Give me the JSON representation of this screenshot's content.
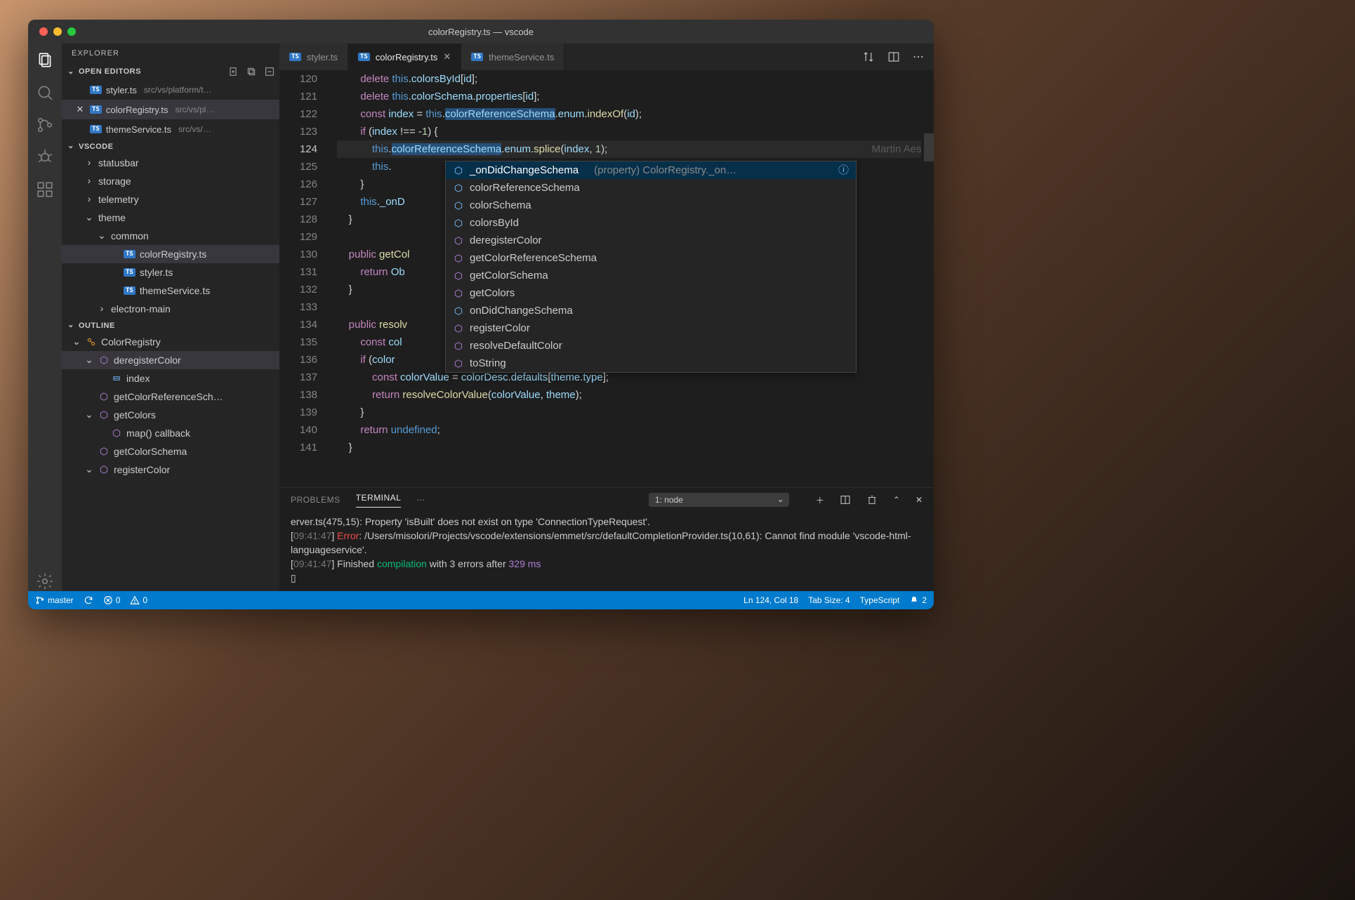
{
  "title": "colorRegistry.ts — vscode",
  "sidebar": {
    "title": "EXPLORER",
    "openEditors": {
      "label": "OPEN EDITORS",
      "items": [
        {
          "name": "styler.ts",
          "path": "src/vs/platform/t…"
        },
        {
          "name": "colorRegistry.ts",
          "path": "src/vs/pl…",
          "active": true
        },
        {
          "name": "themeService.ts",
          "path": "src/vs/…"
        }
      ]
    },
    "workspace": {
      "label": "VSCODE",
      "tree": [
        {
          "indent": 1,
          "chev": "›",
          "label": "statusbar"
        },
        {
          "indent": 1,
          "chev": "›",
          "label": "storage"
        },
        {
          "indent": 1,
          "chev": "›",
          "label": "telemetry"
        },
        {
          "indent": 1,
          "chev": "⌄",
          "label": "theme"
        },
        {
          "indent": 2,
          "chev": "⌄",
          "label": "common"
        },
        {
          "indent": 3,
          "chev": "",
          "label": "colorRegistry.ts",
          "ts": true,
          "active": true
        },
        {
          "indent": 3,
          "chev": "",
          "label": "styler.ts",
          "ts": true
        },
        {
          "indent": 3,
          "chev": "",
          "label": "themeService.ts",
          "ts": true
        },
        {
          "indent": 2,
          "chev": "›",
          "label": "electron-main"
        }
      ]
    },
    "outline": {
      "label": "OUTLINE",
      "items": [
        {
          "indent": 0,
          "chev": "⌄",
          "sym": "class",
          "label": "ColorRegistry"
        },
        {
          "indent": 1,
          "chev": "⌄",
          "sym": "method",
          "label": "deregisterColor",
          "active": true
        },
        {
          "indent": 2,
          "chev": "",
          "sym": "var",
          "label": "index"
        },
        {
          "indent": 1,
          "chev": "",
          "sym": "method",
          "label": "getColorReferenceSch…"
        },
        {
          "indent": 1,
          "chev": "⌄",
          "sym": "method",
          "label": "getColors"
        },
        {
          "indent": 2,
          "chev": "",
          "sym": "method",
          "label": "map() callback"
        },
        {
          "indent": 1,
          "chev": "",
          "sym": "method",
          "label": "getColorSchema"
        },
        {
          "indent": 1,
          "chev": "⌄",
          "sym": "method",
          "label": "registerColor"
        }
      ]
    }
  },
  "tabs": [
    {
      "name": "styler.ts"
    },
    {
      "name": "colorRegistry.ts",
      "active": true,
      "close": true
    },
    {
      "name": "themeService.ts"
    }
  ],
  "editor": {
    "startLine": 120,
    "currentLine": 124,
    "blame": "Martin Aesc",
    "selectionText": "colorReferenceSchema",
    "lines": [
      {
        "n": 120,
        "html": "        <span class='kw'>delete</span> <span class='this'>this</span>.<span class='id'>colorsById</span>[<span class='id'>id</span>];"
      },
      {
        "n": 121,
        "html": "        <span class='kw'>delete</span> <span class='this'>this</span>.<span class='id'>colorSchema</span>.<span class='id'>properties</span>[<span class='id'>id</span>];"
      },
      {
        "n": 122,
        "html": "        <span class='kw'>const</span> <span class='id'>index</span> = <span class='this'>this</span>.<span class='sel id'>colorReferenceSchema</span>.<span class='id'>enum</span>.<span class='fn'>indexOf</span>(<span class='id'>id</span>);"
      },
      {
        "n": 123,
        "html": "        <span class='kw'>if</span> (<span class='id'>index</span> !== -<span class='num'>1</span>) {"
      },
      {
        "n": 124,
        "html": "            <span class='this'>this</span>.<span class='sel id'>colorReferenceSchema</span>.<span class='id'>enum</span>.<span class='fn'>splice</span>(<span class='id'>index</span>, <span class='num'>1</span>);",
        "current": true
      },
      {
        "n": 125,
        "html": "            <span class='this'>this</span>."
      },
      {
        "n": 126,
        "html": "        }"
      },
      {
        "n": 127,
        "html": "        <span class='this'>this</span>.<span class='id'>_onD</span>"
      },
      {
        "n": 128,
        "html": "    }"
      },
      {
        "n": 129,
        "html": ""
      },
      {
        "n": 130,
        "html": "    <span class='kw'>public</span> <span class='fn'>getCol</span>"
      },
      {
        "n": 131,
        "html": "        <span class='kw'>return</span> <span class='id'>Ob</span>                                                                );"
      },
      {
        "n": 132,
        "html": "    }"
      },
      {
        "n": 133,
        "html": ""
      },
      {
        "n": 134,
        "html": "    <span class='kw'>public</span> <span class='fn'>resolv</span>                                                               | <span class='type'>un</span>"
      },
      {
        "n": 135,
        "html": "        <span class='kw'>const</span> <span class='id'>col</span>"
      },
      {
        "n": 136,
        "html": "        <span class='kw'>if</span> (<span class='id'>color</span>"
      },
      {
        "n": 137,
        "html": "            <span class='kw'>const</span> <span class='id'>colorValue</span> = <span class='id'>colorDesc</span>.<span class='id'>defaults</span>[<span class='id'>theme</span>.<span class='id'>type</span>];"
      },
      {
        "n": 138,
        "html": "            <span class='kw'>return</span> <span class='fn'>resolveColorValue</span>(<span class='id'>colorValue</span>, <span class='id'>theme</span>);"
      },
      {
        "n": 139,
        "html": "        }"
      },
      {
        "n": 140,
        "html": "        <span class='kw'>return</span> <span class='this'>undefined</span>;"
      },
      {
        "n": 141,
        "html": "    }"
      }
    ]
  },
  "suggest": {
    "detail": "(property) ColorRegistry._on…",
    "items": [
      {
        "kind": "prop",
        "label": "_onDidChangeSchema",
        "selected": true
      },
      {
        "kind": "prop",
        "label": "colorReferenceSchema"
      },
      {
        "kind": "prop",
        "label": "colorSchema"
      },
      {
        "kind": "prop",
        "label": "colorsById"
      },
      {
        "kind": "meth",
        "label": "deregisterColor"
      },
      {
        "kind": "meth",
        "label": "getColorReferenceSchema"
      },
      {
        "kind": "meth",
        "label": "getColorSchema"
      },
      {
        "kind": "meth",
        "label": "getColors"
      },
      {
        "kind": "prop",
        "label": "onDidChangeSchema"
      },
      {
        "kind": "meth",
        "label": "registerColor"
      },
      {
        "kind": "meth",
        "label": "resolveDefaultColor"
      },
      {
        "kind": "meth",
        "label": "toString"
      }
    ]
  },
  "panel": {
    "tabs": [
      "PROBLEMS",
      "TERMINAL"
    ],
    "active": "TERMINAL",
    "terminalSelect": "1: node",
    "lines": [
      "erver.ts(475,15): Property 'isBuilt' does not exist on type 'ConnectionTypeRequest'.",
      "[<span class='t-time'>09:41:47</span>] <span class='t-err'>Error</span>: /Users/misolori/Projects/vscode/extensions/emmet/src/defaultCompletionProvider.ts(10,61): Cannot find module 'vscode-html-languageservice'.",
      "[<span class='t-time'>09:41:47</span>] Finished <span class='t-ok'>compilation</span> with 3 errors after <span class='t-num'>329 ms</span>",
      "▯"
    ]
  },
  "status": {
    "branch": "master",
    "errors": "0",
    "warnings": "0",
    "lncol": "Ln 124, Col 18",
    "tab": "Tab Size: 4",
    "lang": "TypeScript",
    "bell": "2"
  }
}
